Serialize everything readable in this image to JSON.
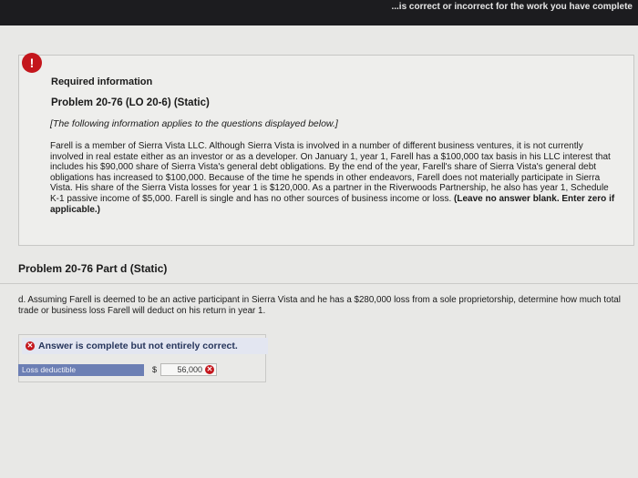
{
  "top_bar": {
    "message": "...is correct or incorrect for the work you have complete"
  },
  "alert": {
    "symbol": "!"
  },
  "info_panel": {
    "required_title": "Required information",
    "problem_title": "Problem 20-76 (LO 20-6) (Static)",
    "instructions": "[The following information applies to the questions displayed below.]",
    "scenario_text": "Farell is a member of Sierra Vista LLC. Although Sierra Vista is involved in a number of different business ventures, it is not currently involved in real estate either as an investor or as a developer. On January 1, year 1, Farell has a $100,000 tax basis in his LLC interest that includes his $90,000 share of Sierra Vista's general debt obligations. By the end of the year, Farell's share of Sierra Vista's general debt obligations has increased to $100,000. Because of the time he spends in other endeavors, Farell does not materially participate in Sierra Vista. His share of the Sierra Vista losses for year 1 is $120,000. As a partner in the Riverwoods Partnership, he also has year 1, Schedule K-1 passive income of $5,000. Farell is single and has no other sources of business income or loss.",
    "scenario_note": "(Leave no answer blank. Enter zero if applicable.)"
  },
  "part": {
    "title": "Problem 20-76 Part d (Static)",
    "question": "d. Assuming Farell is deemed to be an active participant in Sierra Vista and he has a $280,000 loss from a sole proprietorship, determine how much total trade or business loss Farell will deduct on his return in year 1."
  },
  "result": {
    "status_text": "Answer is complete but not entirely correct.",
    "status_icon": "x-circle-icon",
    "status_color": "#c4161c",
    "row_label": "Loss deductible",
    "currency_symbol": "$",
    "answer_value": "56,000",
    "answer_status": "incorrect"
  },
  "colors": {
    "top_bar": "#1c1c1f",
    "alert_red": "#c4161c",
    "label_blue": "#6c7fb4",
    "banner_text": "#26355b"
  }
}
